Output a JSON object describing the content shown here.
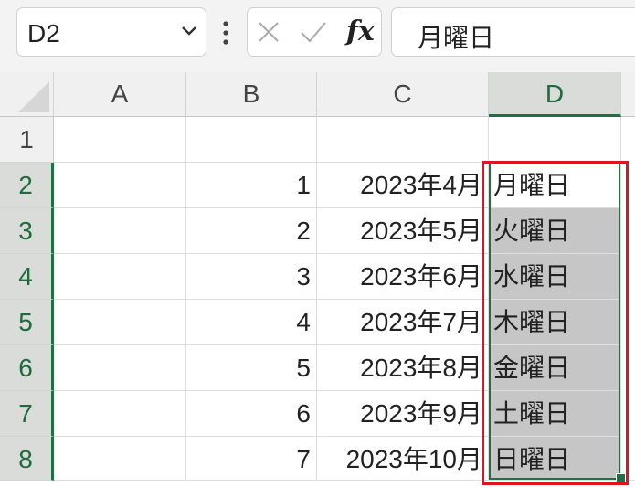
{
  "namebox": {
    "value": "D2"
  },
  "formula_bar": {
    "value": "月曜日",
    "fx_label": "fx"
  },
  "columns": [
    "A",
    "B",
    "C",
    "D"
  ],
  "rows": [
    "1",
    "2",
    "3",
    "4",
    "5",
    "6",
    "7",
    "8"
  ],
  "cells": {
    "B": [
      "",
      "1",
      "2",
      "3",
      "4",
      "5",
      "6",
      "7"
    ],
    "C": [
      "",
      "2023年4月",
      "2023年5月",
      "2023年6月",
      "2023年7月",
      "2023年8月",
      "2023年9月",
      "2023年10月"
    ],
    "D": [
      "",
      "月曜日",
      "火曜日",
      "水曜日",
      "木曜日",
      "金曜日",
      "土曜日",
      "日曜日"
    ]
  },
  "colors": {
    "selection": "#1e7145",
    "annotation": "#e0141e",
    "selected_fill": "#c6c6c6"
  }
}
